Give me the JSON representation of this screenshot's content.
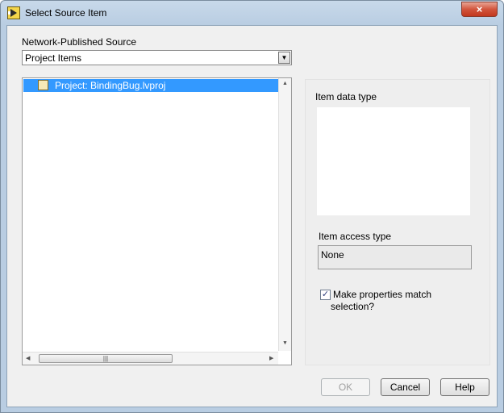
{
  "window": {
    "title": "Select Source Item",
    "close_label": "×"
  },
  "source": {
    "label": "Network-Published Source",
    "selected": "Project Items"
  },
  "tree": {
    "items": [
      {
        "label": "Project: BindingBug.lvproj",
        "selected": true
      }
    ]
  },
  "panel": {
    "data_type_label": "Item data type",
    "access_type_label": "Item access type",
    "access_type_value": "None",
    "match_checkbox": {
      "checked": true,
      "label_line1": "Make properties match",
      "label_line2": "selection?"
    }
  },
  "buttons": {
    "ok": "OK",
    "cancel": "Cancel",
    "help": "Help"
  },
  "glyphs": {
    "check": "✓",
    "combo_arrow": "▼",
    "scroll_up": "▲",
    "scroll_down": "▼",
    "scroll_left": "◀",
    "scroll_right": "▶",
    "thumb_grip": "|||"
  }
}
